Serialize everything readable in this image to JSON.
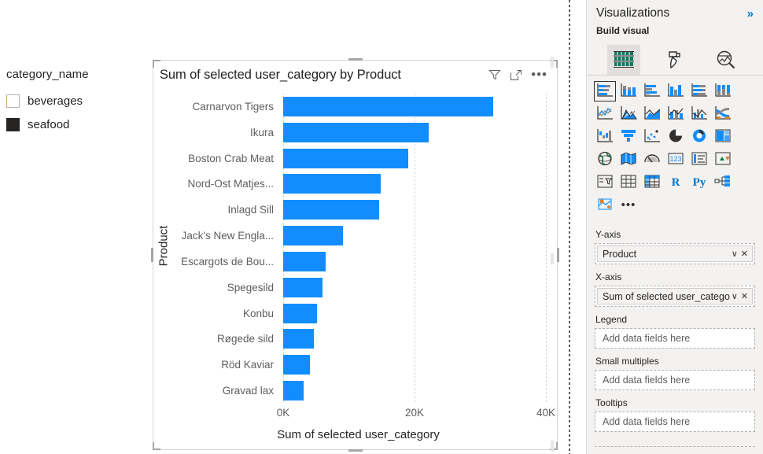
{
  "slicer": {
    "title": "category_name",
    "items": [
      {
        "label": "beverages",
        "checked": false
      },
      {
        "label": "seafood",
        "checked": true
      }
    ]
  },
  "visual": {
    "title": "Sum of selected user_category by Product",
    "header_icons": [
      {
        "name": "filter-icon",
        "glyph": "filter"
      },
      {
        "name": "focus-mode-icon",
        "glyph": "focus"
      },
      {
        "name": "more-options-icon",
        "glyph": "•••"
      }
    ]
  },
  "chart_data": {
    "type": "bar",
    "title": "Sum of selected user_category by Product",
    "orientation": "horizontal",
    "xlabel": "Sum of selected user_category",
    "ylabel": "Product",
    "xlim": [
      0,
      40000
    ],
    "xticks": [
      "0K",
      "20K",
      "40K"
    ],
    "xtick_values": [
      0,
      20000,
      40000
    ],
    "grid": true,
    "legend": "none",
    "bar_color": "#118DFF",
    "categories": [
      "Carnarvon Tigers",
      "Ikura",
      "Boston Crab Meat",
      "Nord-Ost Matjes...",
      "Inlagd Sill",
      "Jack's New Engla...",
      "Escargots de Bou...",
      "Spegesild",
      "Konbu",
      "Røgede sild",
      "Röd Kaviar",
      "Gravad lax"
    ],
    "values": [
      32000,
      22100,
      19000,
      14800,
      14600,
      9100,
      6500,
      6000,
      5200,
      4700,
      4100,
      3100
    ]
  },
  "pane": {
    "title": "Visualizations",
    "collapse_glyph": "»",
    "subtitle": "Build visual",
    "tabs": [
      {
        "name": "build-visual",
        "icon": "grid-icon",
        "active": true
      },
      {
        "name": "format-visual",
        "icon": "paint-roller-icon",
        "active": false
      },
      {
        "name": "analytics",
        "icon": "magnifier-chart-icon",
        "active": false
      }
    ],
    "gallery": [
      {
        "name": "stacked-bar-chart",
        "selected": true
      },
      {
        "name": "stacked-column-chart",
        "selected": false
      },
      {
        "name": "clustered-bar-chart",
        "selected": false
      },
      {
        "name": "clustered-column-chart",
        "selected": false
      },
      {
        "name": "100-percent-stacked-bar-chart",
        "selected": false
      },
      {
        "name": "100-percent-stacked-column-chart",
        "selected": false
      },
      {
        "name": "line-chart",
        "selected": false
      },
      {
        "name": "area-chart",
        "selected": false
      },
      {
        "name": "stacked-area-chart",
        "selected": false
      },
      {
        "name": "line-and-stacked-column-chart",
        "selected": false
      },
      {
        "name": "line-and-clustered-column-chart",
        "selected": false
      },
      {
        "name": "ribbon-chart",
        "selected": false
      },
      {
        "name": "waterfall-chart",
        "selected": false
      },
      {
        "name": "funnel-chart",
        "selected": false
      },
      {
        "name": "scatter-chart",
        "selected": false
      },
      {
        "name": "pie-chart",
        "selected": false
      },
      {
        "name": "donut-chart",
        "selected": false
      },
      {
        "name": "treemap",
        "selected": false
      },
      {
        "name": "map",
        "selected": false
      },
      {
        "name": "filled-map",
        "selected": false
      },
      {
        "name": "gauge-chart",
        "selected": false
      },
      {
        "name": "card",
        "selected": false
      },
      {
        "name": "multi-row-card",
        "selected": false
      },
      {
        "name": "kpi",
        "selected": false
      },
      {
        "name": "slicer",
        "selected": false
      },
      {
        "name": "table",
        "selected": false
      },
      {
        "name": "matrix",
        "selected": false
      },
      {
        "name": "r-script-visual",
        "selected": false,
        "text": "R"
      },
      {
        "name": "python-visual",
        "selected": false,
        "text": "Py"
      },
      {
        "name": "decomposition-tree",
        "selected": false
      },
      {
        "name": "azure-map",
        "selected": false
      },
      {
        "name": "more-visuals",
        "selected": false,
        "text": "•••"
      }
    ],
    "wells": [
      {
        "name": "y-axis",
        "label": "Y-axis",
        "field": "Product",
        "placeholder": ""
      },
      {
        "name": "x-axis",
        "label": "X-axis",
        "field": "Sum of selected user_category",
        "placeholder": ""
      },
      {
        "name": "legend",
        "label": "Legend",
        "field": null,
        "placeholder": "Add data fields here"
      },
      {
        "name": "small-multiples",
        "label": "Small multiples",
        "field": null,
        "placeholder": "Add data fields here"
      },
      {
        "name": "tooltips",
        "label": "Tooltips",
        "field": null,
        "placeholder": "Add data fields here"
      }
    ],
    "pill_icons": {
      "dropdown": "∨",
      "remove": "✕"
    }
  }
}
